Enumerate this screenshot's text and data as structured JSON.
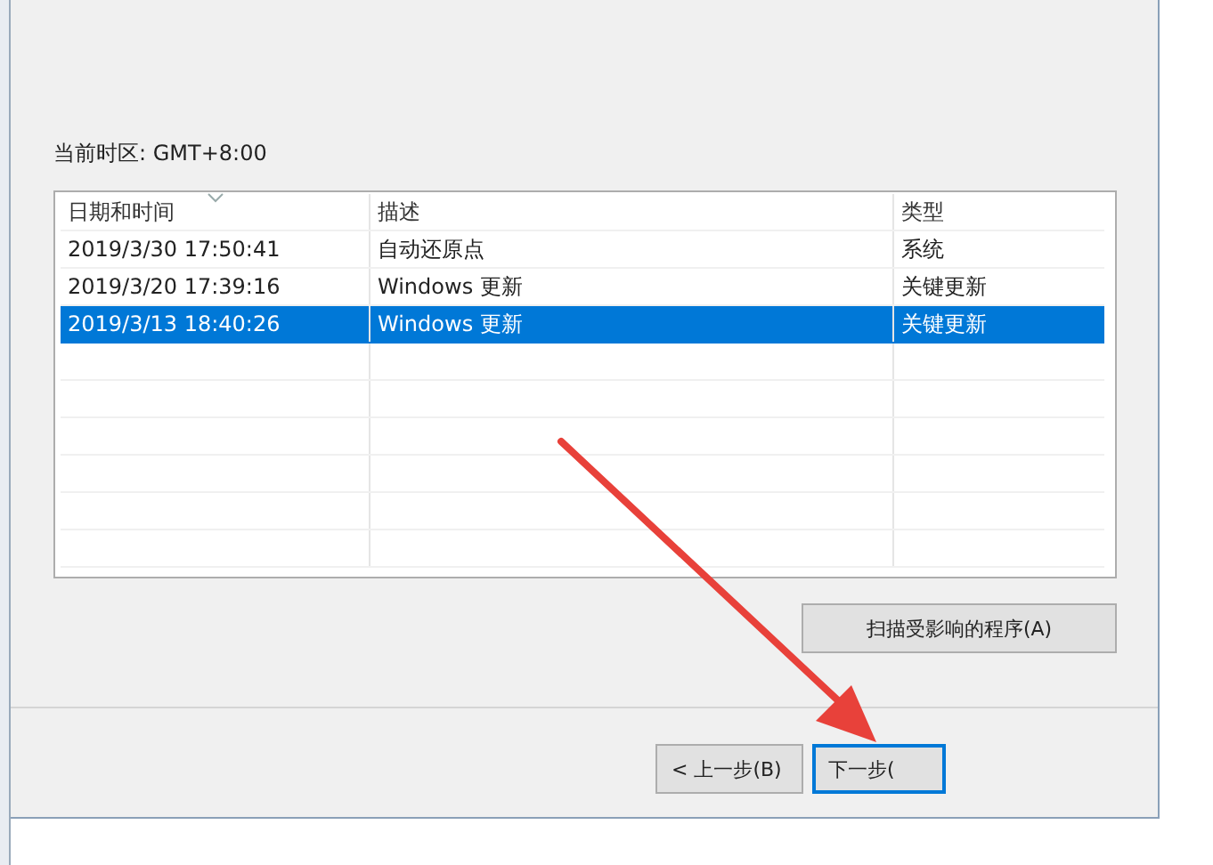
{
  "timezone_label": "当前时区: GMT+8:00",
  "table": {
    "columns": [
      {
        "label": "日期和时间",
        "sorted": true
      },
      {
        "label": "描述",
        "sorted": false
      },
      {
        "label": "类型",
        "sorted": false
      }
    ],
    "rows": [
      {
        "cells": [
          "2019/3/30 17:50:41",
          "自动还原点",
          "系统"
        ],
        "selected": false
      },
      {
        "cells": [
          "2019/3/20 17:39:16",
          "Windows 更新",
          "关键更新"
        ],
        "selected": false
      },
      {
        "cells": [
          "2019/3/13 18:40:26",
          "Windows 更新",
          "关键更新"
        ],
        "selected": true
      }
    ]
  },
  "scan_button": "扫描受影响的程序(A)",
  "buttons": [
    {
      "label": "< 上一步(B)",
      "focused": false
    },
    {
      "label": "下一步(",
      "focused": true
    }
  ]
}
